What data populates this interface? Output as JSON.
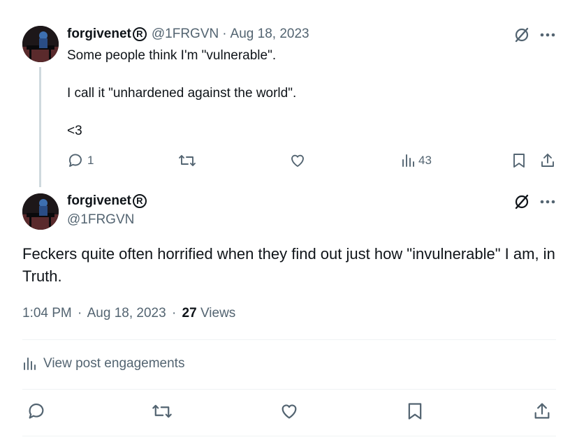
{
  "reply_tweet": {
    "display_name": "forgivenet",
    "badge": "R",
    "handle": "@1FRGVN",
    "separator": "·",
    "date": "Aug 18, 2023",
    "text_line1": "Some people think I'm \"vulnerable\".",
    "text_line2": "I call it \"unhardened against the world\".",
    "text_line3": "<3",
    "reply_count": "1",
    "views_count": "43"
  },
  "main_tweet": {
    "display_name": "forgivenet",
    "badge": "R",
    "handle": "@1FRGVN",
    "text": "Feckers quite often horrified when they find out just how \"invulnerable\" I am, in Truth.",
    "time": "1:04 PM",
    "separator": "·",
    "date": "Aug 18, 2023",
    "separator2": "·",
    "views_number": "27",
    "views_label": "Views",
    "engagements_label": "View post engagements"
  },
  "colors": {
    "text": "#0f1419",
    "muted": "#536471",
    "divider": "#eff3f4",
    "thread_line": "#cfd9de"
  },
  "icons": [
    "grok-icon",
    "more-icon",
    "reply-icon",
    "retweet-icon",
    "like-icon",
    "views-icon",
    "bookmark-icon",
    "share-icon"
  ]
}
